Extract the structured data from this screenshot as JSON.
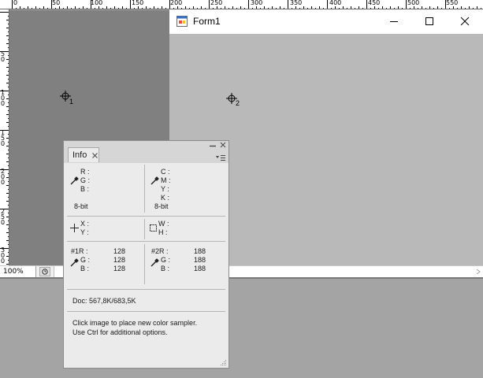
{
  "ruler": {
    "top_labels": [
      "0",
      "50",
      "100",
      "150",
      "200",
      "250",
      "300",
      "350",
      "400",
      "450",
      "500",
      "550"
    ],
    "left_labels": [
      "5 0",
      "1 0 0",
      "1 5 0",
      "2 0 0",
      "2 5 0",
      "3 0 0"
    ]
  },
  "form": {
    "title": "Form1"
  },
  "samplers": {
    "one": "1",
    "two": "2"
  },
  "status": {
    "zoom": "100%"
  },
  "info_panel": {
    "tab_label": "Info",
    "rgb_labels": [
      "R :",
      "G :",
      "B :"
    ],
    "cmyk_labels": [
      "C :",
      "M :",
      "Y :",
      "K :"
    ],
    "bit_depth_left": "8-bit",
    "bit_depth_right": "8-bit",
    "xy_labels": [
      "X :",
      "Y :"
    ],
    "wh_labels": [
      "W :",
      "H :"
    ],
    "sampler1": {
      "labels": [
        "#1R :",
        "G :",
        "B :"
      ],
      "values": [
        "128",
        "128",
        "128"
      ]
    },
    "sampler2": {
      "labels": [
        "#2R :",
        "G :",
        "B :"
      ],
      "values": [
        "188",
        "188",
        "188"
      ]
    },
    "doc": "Doc: 567,8K/683,5K",
    "hint_line1": "Click image to place new color sampler.",
    "hint_line2": "Use Ctrl for additional options."
  },
  "colors": {
    "canvas_dark": "#808080",
    "canvas_light": "#b9b9b9",
    "panel_bg": "#ebebeb",
    "workspace": "#a4a4a4"
  },
  "icons": [
    "eyedropper-icon",
    "crosshair-icon",
    "marquee-icon",
    "sampler-target-icon",
    "form-app-icon",
    "minimize-icon",
    "maximize-icon",
    "close-icon",
    "panel-menu-icon",
    "resize-grip-icon",
    "clock-icon",
    "scroll-right-icon"
  ]
}
